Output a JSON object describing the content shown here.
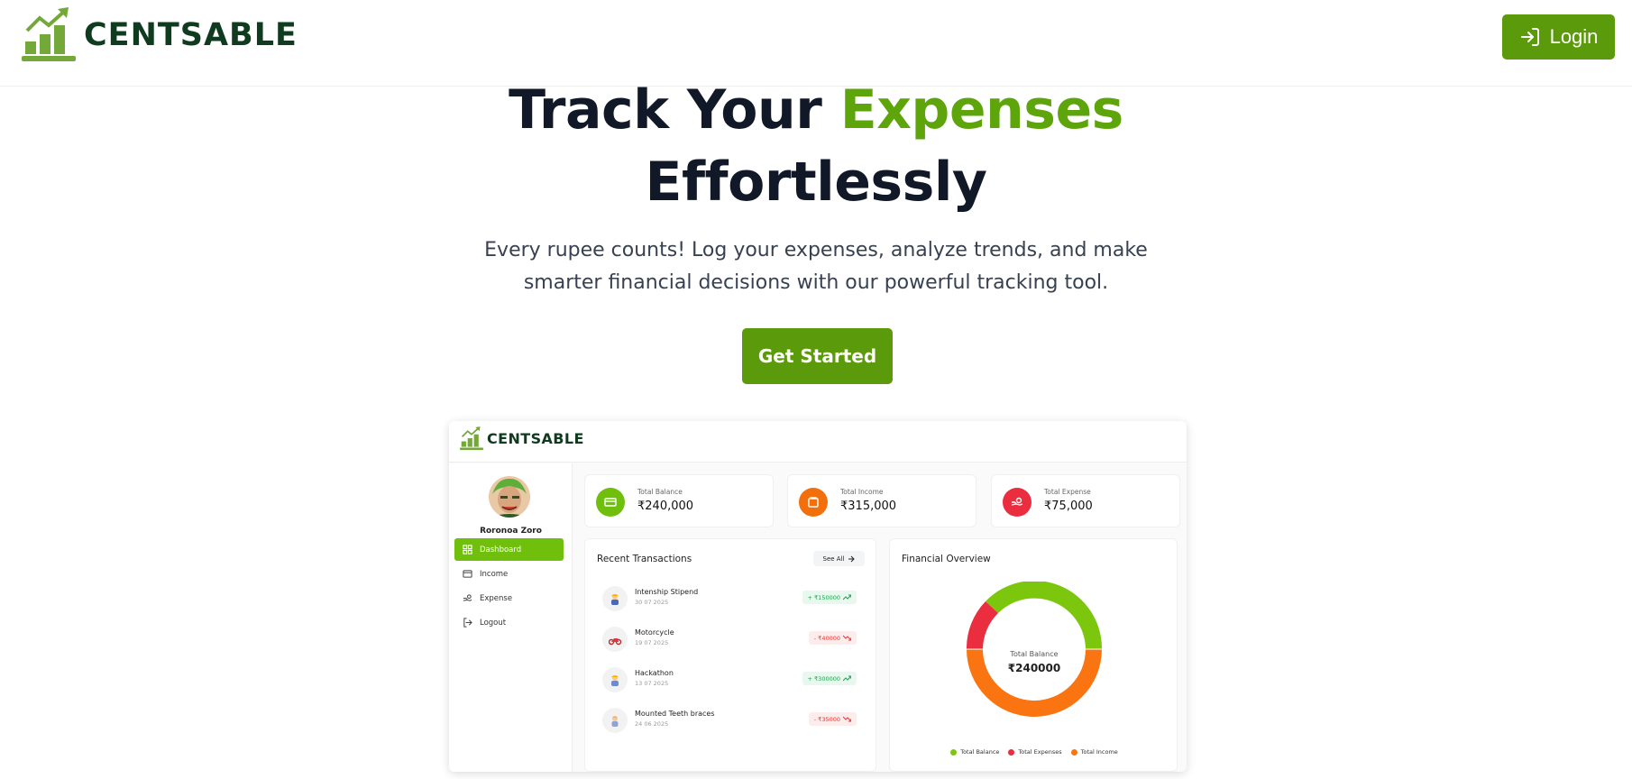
{
  "brand": {
    "name": "CENTSABLE"
  },
  "nav": {
    "login_label": "Login"
  },
  "hero": {
    "title_part1": "Track Your ",
    "title_accent": "Expenses",
    "title_line2": "Effortlessly",
    "subtitle_line1": "Every rupee counts! Log your expenses, analyze trends, and make",
    "subtitle_line2": "smarter financial decisions with our powerful tracking tool.",
    "cta_label": "Get Started"
  },
  "preview": {
    "brand": "CENTSABLE",
    "user_name": "Roronoa Zoro",
    "menu": [
      {
        "label": "Dashboard",
        "icon": "grid-icon",
        "active": true
      },
      {
        "label": "Income",
        "icon": "wallet-icon",
        "active": false
      },
      {
        "label": "Expense",
        "icon": "hand-coins-icon",
        "active": false
      },
      {
        "label": "Logout",
        "icon": "logout-icon",
        "active": false
      }
    ],
    "stats": [
      {
        "label": "Total Balance",
        "value": "₹240,000",
        "color": "#6fbf0c",
        "icon": "card-icon"
      },
      {
        "label": "Total Income",
        "value": "₹315,000",
        "color": "#f26f0c",
        "icon": "wallet-icon"
      },
      {
        "label": "Total Expense",
        "value": "₹75,000",
        "color": "#ea2d3f",
        "icon": "hand-coins-icon"
      }
    ],
    "recent": {
      "title": "Recent Transactions",
      "see_all_label": "See All",
      "items": [
        {
          "name": "Intenship Stipend",
          "date": "30 07 2025",
          "amount": "+ ₹150000",
          "direction": "up",
          "icon": "worker-icon"
        },
        {
          "name": "Motorcycle",
          "date": "19 07 2025",
          "amount": "- ₹40000",
          "direction": "down",
          "icon": "motorcycle-icon"
        },
        {
          "name": "Hackathon",
          "date": "13 07 2025",
          "amount": "+ ₹300000",
          "direction": "up",
          "icon": "worker-icon"
        },
        {
          "name": "Mounted Teeth braces",
          "date": "24 06 2025",
          "amount": "- ₹35000",
          "direction": "down",
          "icon": "person-icon"
        }
      ]
    },
    "overview": {
      "title": "Financial Overview",
      "center_label": "Total Balance",
      "center_value": "₹240000",
      "legend": [
        {
          "label": "Total Balance",
          "color": "#7cc70e"
        },
        {
          "label": "Total Expenses",
          "color": "#ea2d3f"
        },
        {
          "label": "Total Income",
          "color": "#fa7412"
        }
      ]
    }
  },
  "colors": {
    "brand_green": "#5b9a0a",
    "accent_green": "#5ea50c",
    "dark_green": "#0f3b1e"
  }
}
